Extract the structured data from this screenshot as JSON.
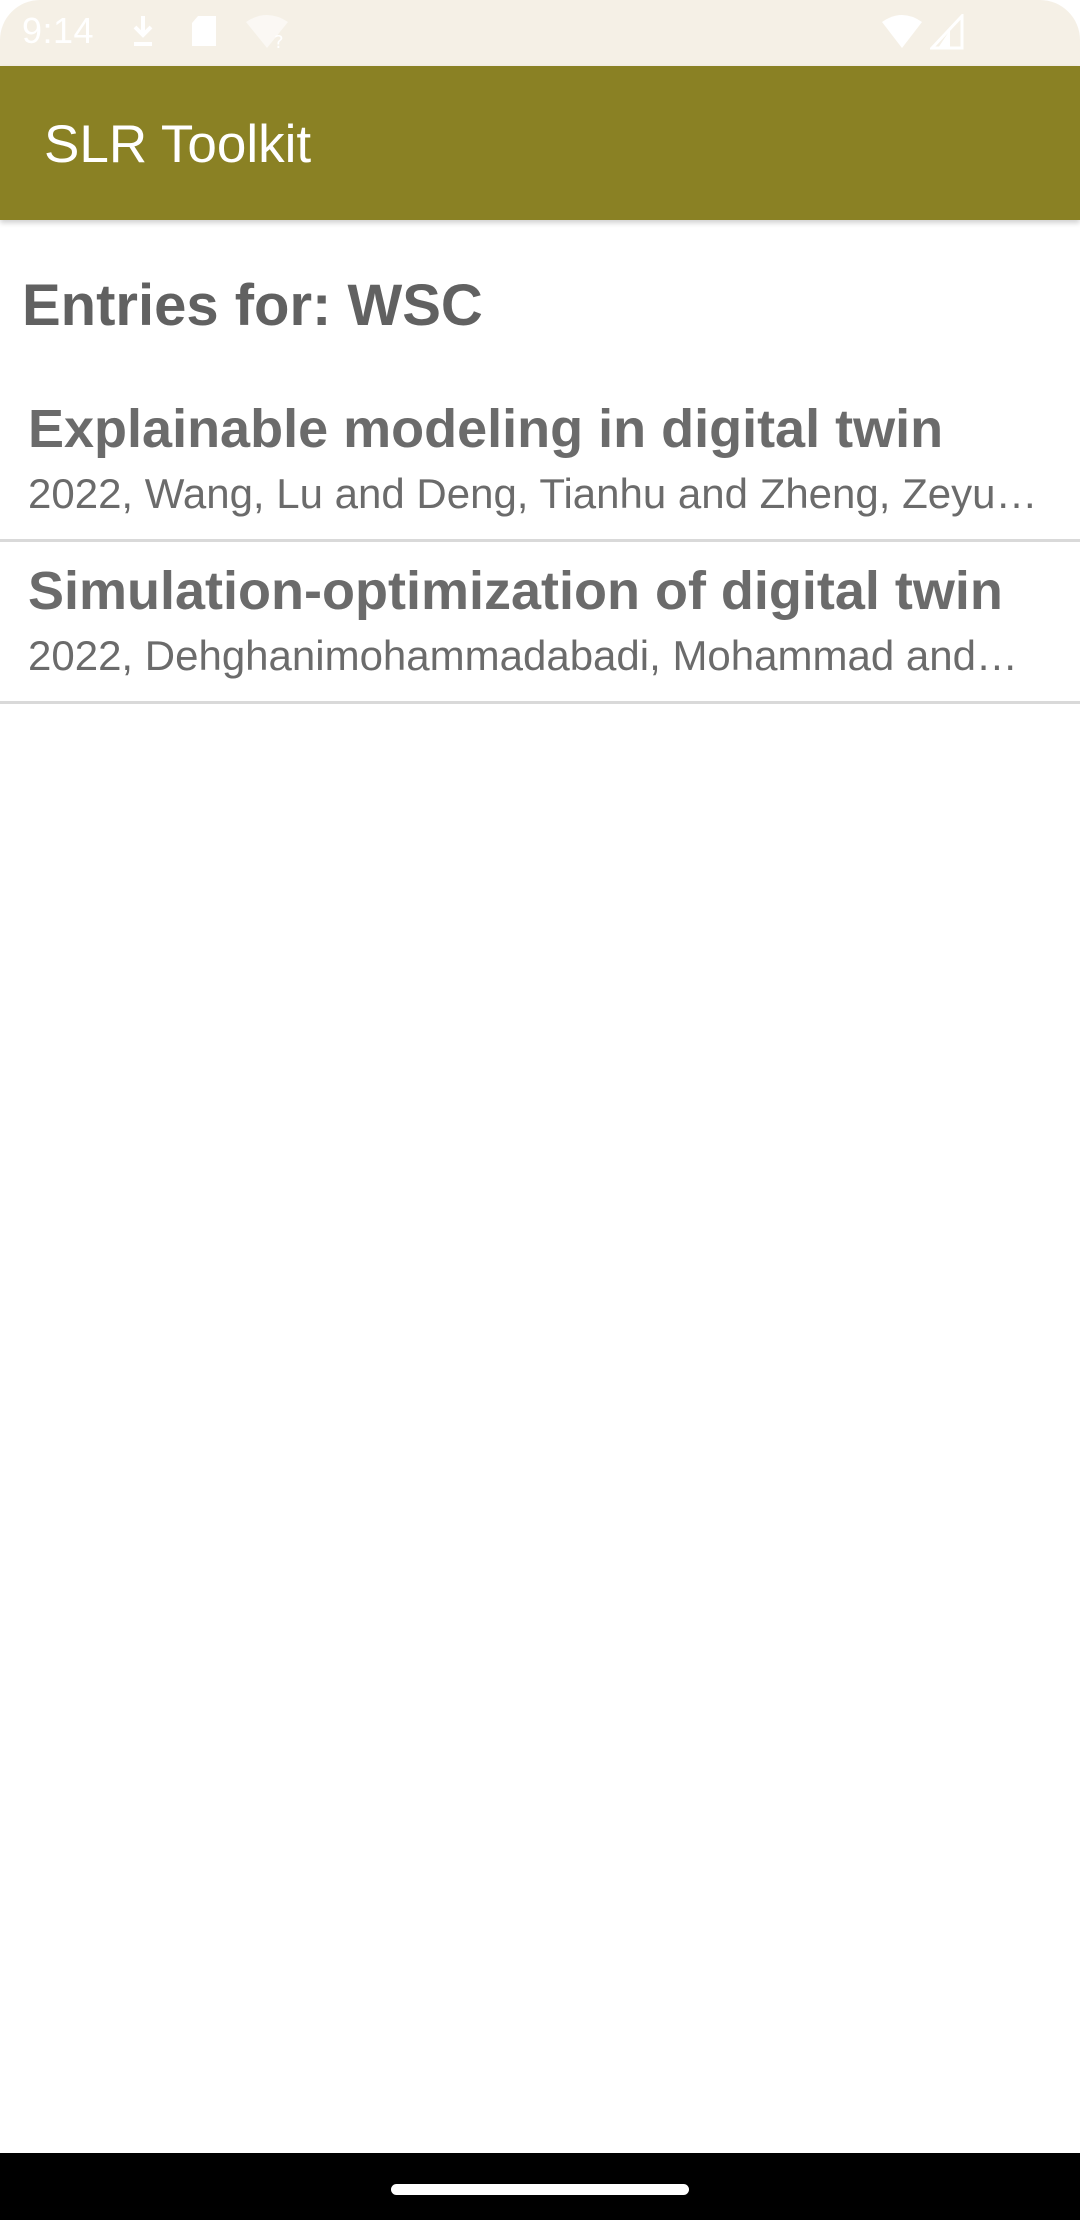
{
  "status_bar": {
    "time": "9:14",
    "icons": [
      "download-icon",
      "sd-card-icon",
      "wifi-question-icon",
      "wifi-icon",
      "signal-icon"
    ]
  },
  "app_bar": {
    "title": "SLR Toolkit",
    "color": "#8a8124"
  },
  "main": {
    "heading": "Entries for: WSC",
    "entries": [
      {
        "title": "Explainable modeling in digital twin",
        "subtitle": "2022, Wang, Lu and Deng, Tianhu and Zheng, Zeyu…"
      },
      {
        "title": "Simulation-optimization of digital twin",
        "subtitle": "2022, Dehghanimohammadabadi, Mohammad and…"
      }
    ]
  }
}
